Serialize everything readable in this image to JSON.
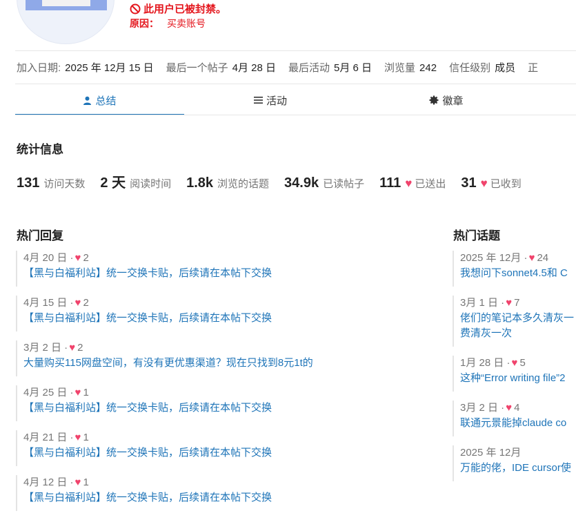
{
  "user": {
    "banned_text": "此用户已被封禁。",
    "reason_label": "原因：",
    "reason_value": "买卖账号"
  },
  "meta": [
    {
      "label": "加入日期:",
      "value": "2025 年 12月 15 日"
    },
    {
      "label": "最后一个帖子",
      "value": "4月 28 日"
    },
    {
      "label": "最后活动",
      "value": "5月 6 日"
    },
    {
      "label": "浏览量",
      "value": "242"
    },
    {
      "label": "信任级别",
      "value": "成员"
    },
    {
      "label": "正",
      "value": ""
    }
  ],
  "tabs": [
    {
      "label": "总结",
      "icon": "user-icon"
    },
    {
      "label": "活动",
      "icon": "list-icon"
    },
    {
      "label": "徽章",
      "icon": "badge-icon"
    }
  ],
  "stats_title": "统计信息",
  "stats": [
    {
      "num": "131",
      "label": "访问天数"
    },
    {
      "num": "2 天",
      "label": "阅读时间"
    },
    {
      "num": "1.8k",
      "label": "浏览的话题"
    },
    {
      "num": "34.9k",
      "label": "已读帖子"
    },
    {
      "num": "111",
      "label": "已送出",
      "heart": "♥"
    },
    {
      "num": "31",
      "label": "已收到",
      "heart": "♥"
    }
  ],
  "top_replies_title": "热门回复",
  "top_replies": [
    {
      "date": "4月 20 日 ·",
      "likes": "2",
      "title": "【黑与白福利站】统一交换卡贴，后续请在本帖下交换"
    },
    {
      "date": "4月 15 日 ·",
      "likes": "2",
      "title": "【黑与白福利站】统一交换卡贴，后续请在本帖下交换"
    },
    {
      "date": "3月 2 日 ·",
      "likes": "2",
      "title": "大量购买115网盘空间，有没有更优惠渠道？现在只找到8元1t的"
    },
    {
      "date": "4月 25 日 ·",
      "likes": "1",
      "title": "【黑与白福利站】统一交换卡贴，后续请在本帖下交换"
    },
    {
      "date": "4月 21 日 ·",
      "likes": "1",
      "title": "【黑与白福利站】统一交换卡贴，后续请在本帖下交换"
    },
    {
      "date": "4月 12 日 ·",
      "likes": "1",
      "title": "【黑与白福利站】统一交换卡贴，后续请在本帖下交换"
    }
  ],
  "top_topics_title": "热门话题",
  "top_topics": [
    {
      "date": "2025 年 12月 ·",
      "likes": "24",
      "title": "我想问下sonnet4.5和 C"
    },
    {
      "date": "3月 1 日 ·",
      "likes": "7",
      "title": "佬们的笔记本多久清灰一",
      "title2": "费清灰一次"
    },
    {
      "date": "1月 28 日 ·",
      "likes": "5",
      "title": "这种“Error writing file”2"
    },
    {
      "date": "3月 2 日 ·",
      "likes": "4",
      "title": "联通元景能掉claude co"
    },
    {
      "date": "2025 年 12月",
      "likes": "",
      "title": "万能的佬，IDE cursor使"
    }
  ],
  "colors": {
    "accent": "#1e74b8",
    "danger": "#e4161d",
    "heart": "#f0436c"
  }
}
